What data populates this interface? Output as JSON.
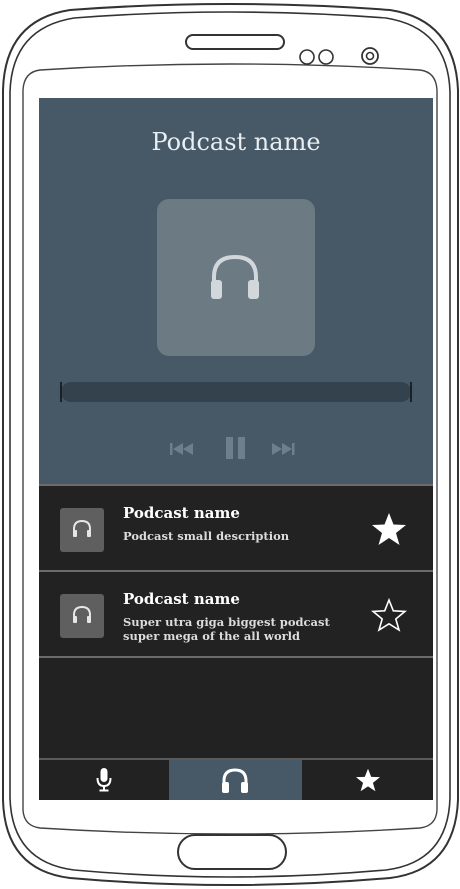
{
  "player": {
    "title": "Podcast name",
    "progress": 0,
    "controls": [
      "previous-icon",
      "pause-icon",
      "next-icon"
    ]
  },
  "list": {
    "items": [
      {
        "title": "Podcast name",
        "description": "Podcast small description",
        "favorite": true
      },
      {
        "title": "Podcast name",
        "description": "Super utra giga biggest podcast super mega of the all world",
        "favorite": false
      }
    ]
  },
  "tabbar": {
    "tabs": [
      {
        "icon": "microphone-icon",
        "active": false
      },
      {
        "icon": "headphones-icon",
        "active": true
      },
      {
        "icon": "star-icon",
        "active": false
      }
    ]
  },
  "colors": {
    "player_bg": "#475966",
    "list_bg": "#222222",
    "active_tab": "#475966"
  }
}
